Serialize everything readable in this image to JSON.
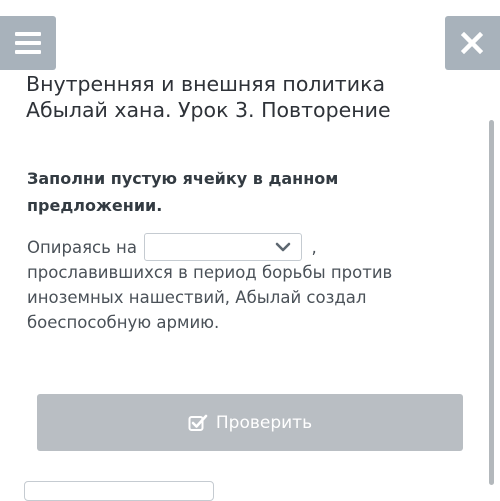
{
  "header": {
    "menu_icon": "hamburger-menu-icon",
    "close_icon": "close-icon",
    "title": "Внутренняя и внешняя политика Абылай хана. Урок 3. Повторение"
  },
  "task": {
    "instruction": "Заполни пустую ячейку в данном предложении.",
    "sentence_before": "Опираясь на",
    "sentence_after": ", прославившихся в период борьбы против иноземных нашествий, Абылай создал боеспособную армию.",
    "dropdown": {
      "selected_value": "",
      "icon": "chevron-down-icon"
    }
  },
  "actions": {
    "check_label": "Проверить",
    "check_icon": "checkbox-check-icon"
  },
  "colors": {
    "header_button_bg": "#a8b2bb",
    "check_button_bg": "#b9bec3",
    "text": "#333b42"
  }
}
